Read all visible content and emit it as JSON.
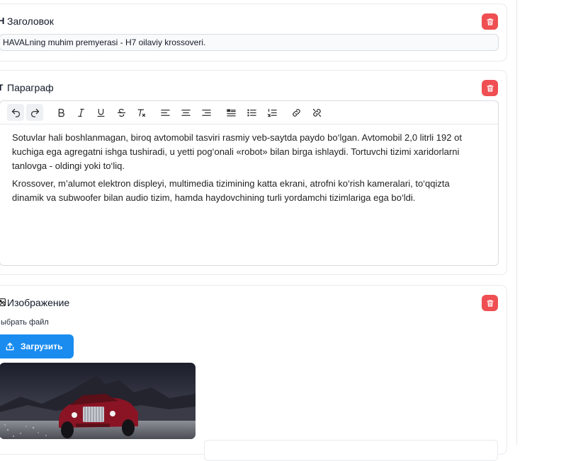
{
  "heading_block": {
    "title": "Заголовок",
    "icon": "heading-icon",
    "value": "HAVALning muhim premyerasi - H7 oilaviy krossoveri."
  },
  "paragraph_block": {
    "title": "Параграф",
    "icon": "paragraph-icon",
    "toolbar": [
      "undo",
      "redo",
      "bold",
      "italic",
      "underline",
      "strikethrough",
      "clear-format",
      "align-left",
      "align-center",
      "align-right",
      "blockquote",
      "bullet-list",
      "numbered-list",
      "link",
      "unlink"
    ],
    "paragraphs": [
      "Sotuvlar hali boshlanmagan, biroq avtomobil tasviri rasmiy veb-saytda paydo bo‘lgan. Avtomobil 2,0 litrli 192 ot kuchiga ega agregatni ishga tushiradi, u yetti pog‘onali «robot» bilan birga ishlaydi. Tortuvchi tizimi xaridorlarni tanlovga - oldingi yoki to‘liq.",
      "Krossover, m’alumot elektron displeyi, multimedia tizimining katta ekrani, atrofni ko‘rish kameralari, to‘qqizta dinamik va subwoofer bilan audio tizim, hamda haydovchining turli yordamchi tizimlariga ega bo‘ldi."
    ]
  },
  "image_block": {
    "title": "Изображение",
    "icon": "image-icon",
    "file_label": "ыбрать файл",
    "upload_label": "Загрузить"
  },
  "colors": {
    "delete": "#ef4f52",
    "upload": "#1a8cf0",
    "border": "#e8eaee"
  }
}
